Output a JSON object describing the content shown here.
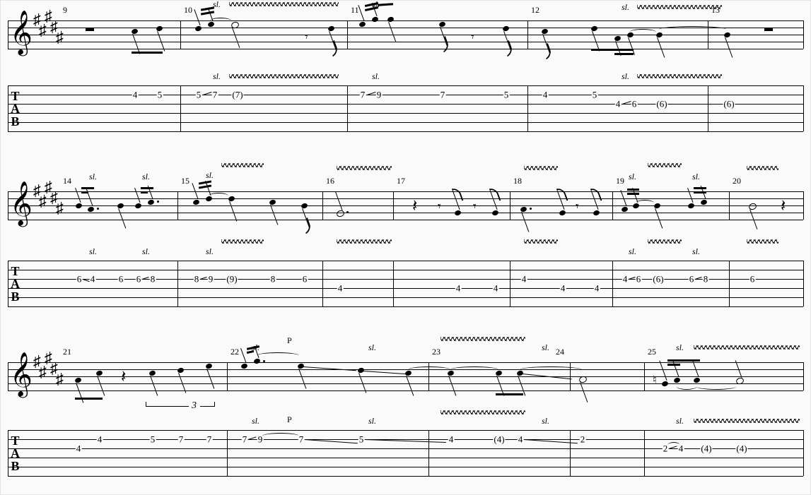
{
  "notation": {
    "clef": "treble",
    "key_signature": {
      "sharps": 5,
      "key": "B major / G# minor"
    },
    "tab_clef": [
      "T",
      "A",
      "B"
    ]
  },
  "annotations": {
    "slide": "sl.",
    "pulloff": "P",
    "tuplet3": "3"
  },
  "systems": [
    {
      "measures": [
        {
          "number": "9",
          "staff_events": [
            {
              "kind": "rest",
              "dur": "half"
            },
            {
              "kind": "note",
              "dur": "8"
            },
            {
              "kind": "note",
              "dur": "8"
            }
          ],
          "tab": [
            {
              "string": 2,
              "fret": "4"
            },
            {
              "string": 2,
              "fret": "5"
            }
          ],
          "ornaments": []
        },
        {
          "number": "10",
          "staff_events": [
            {
              "kind": "note",
              "dur": "16",
              "slide_to_next": true
            },
            {
              "kind": "note",
              "dur": "16"
            },
            {
              "kind": "note",
              "dur": "half",
              "tied_from_prev": true,
              "vibrato": true
            },
            {
              "kind": "rest",
              "dur": "8"
            },
            {
              "kind": "note",
              "dur": "8"
            }
          ],
          "tab": [
            {
              "string": 2,
              "fret": "5",
              "slide": true
            },
            {
              "string": 2,
              "fret": "7"
            },
            {
              "string": 2,
              "fret": "(7)"
            }
          ],
          "ornaments": [
            "sl.",
            "vibrato"
          ]
        },
        {
          "number": "11",
          "staff_events": [
            {
              "kind": "note",
              "dur": "16",
              "slide_to_next": true
            },
            {
              "kind": "note",
              "dur": "16"
            },
            {
              "kind": "note",
              "dur": "8"
            },
            {
              "kind": "note",
              "dur": "8"
            },
            {
              "kind": "rest",
              "dur": "8"
            },
            {
              "kind": "note",
              "dur": "8"
            }
          ],
          "tab": [
            {
              "string": 2,
              "fret": "7",
              "slide": true
            },
            {
              "string": 2,
              "fret": "9"
            },
            {
              "string": 2,
              "fret": "7"
            },
            {
              "string": 2,
              "fret": "5"
            }
          ],
          "ornaments": [
            "sl."
          ]
        },
        {
          "number": "12",
          "staff_events": [
            {
              "kind": "note",
              "dur": "8"
            },
            {
              "kind": "note",
              "dur": "8"
            },
            {
              "kind": "note",
              "dur": "16",
              "slide_to_next": true
            },
            {
              "kind": "note",
              "dur": "16"
            },
            {
              "kind": "note",
              "dur": "q",
              "tied_from_prev": true,
              "vibrato": true
            }
          ],
          "tab": [
            {
              "string": 2,
              "fret": "4"
            },
            {
              "string": 2,
              "fret": "5"
            },
            {
              "string": 3,
              "fret": "4",
              "slide": true
            },
            {
              "string": 3,
              "fret": "6"
            },
            {
              "string": 3,
              "fret": "(6)"
            }
          ],
          "ornaments": [
            "sl.",
            "vibrato"
          ]
        },
        {
          "number": "13",
          "staff_events": [
            {
              "kind": "note",
              "dur": "q",
              "tied_from_prev_measure": true
            },
            {
              "kind": "rest",
              "dur": "half"
            }
          ],
          "tab": [
            {
              "string": 3,
              "fret": "(6)"
            }
          ],
          "ornaments": []
        }
      ]
    },
    {
      "measures": [
        {
          "number": "14",
          "staff_events": [
            {
              "kind": "note",
              "dur": "16",
              "slide_to_next": true
            },
            {
              "kind": "note",
              "dur": "8.",
              "dotted": true
            },
            {
              "kind": "note",
              "dur": "8"
            },
            {
              "kind": "note",
              "dur": "16",
              "slide_to_next": true
            },
            {
              "kind": "note",
              "dur": "8.",
              "dotted": true
            }
          ],
          "tab": [
            {
              "string": 3,
              "fret": "6",
              "slide": true
            },
            {
              "string": 3,
              "fret": "4"
            },
            {
              "string": 3,
              "fret": "6"
            },
            {
              "string": 3,
              "fret": "6",
              "slide": true
            },
            {
              "string": 3,
              "fret": "8"
            }
          ],
          "ornaments": [
            "sl.",
            "sl."
          ]
        },
        {
          "number": "15",
          "staff_events": [
            {
              "kind": "note",
              "dur": "16",
              "slide_to_next": true
            },
            {
              "kind": "note",
              "dur": "16"
            },
            {
              "kind": "note",
              "dur": "q",
              "tied_from_prev": true,
              "vibrato": true
            },
            {
              "kind": "note",
              "dur": "q"
            },
            {
              "kind": "note",
              "dur": "8"
            }
          ],
          "tab": [
            {
              "string": 3,
              "fret": "8",
              "slide": true
            },
            {
              "string": 3,
              "fret": "9"
            },
            {
              "string": 3,
              "fret": "(9)"
            },
            {
              "string": 3,
              "fret": "8"
            },
            {
              "string": 3,
              "fret": "6"
            }
          ],
          "ornaments": [
            "sl.",
            "vibrato"
          ]
        },
        {
          "number": "16",
          "staff_events": [
            {
              "kind": "note",
              "dur": "half.",
              "dotted": true,
              "vibrato": true
            }
          ],
          "tab": [
            {
              "string": 4,
              "fret": "4"
            }
          ],
          "ornaments": [
            "vibrato"
          ]
        },
        {
          "number": "17",
          "staff_events": [
            {
              "kind": "rest",
              "dur": "q"
            },
            {
              "kind": "rest",
              "dur": "8"
            },
            {
              "kind": "note",
              "dur": "8"
            },
            {
              "kind": "rest",
              "dur": "8"
            },
            {
              "kind": "note",
              "dur": "8"
            }
          ],
          "tab": [
            {
              "string": 4,
              "fret": "4"
            },
            {
              "string": 4,
              "fret": "4"
            }
          ],
          "ornaments": []
        },
        {
          "number": "18",
          "staff_events": [
            {
              "kind": "note",
              "dur": "q.",
              "dotted": true,
              "vibrato": true
            },
            {
              "kind": "note",
              "dur": "8"
            },
            {
              "kind": "rest",
              "dur": "8"
            },
            {
              "kind": "note",
              "dur": "8"
            }
          ],
          "tab": [
            {
              "string": 3,
              "fret": "4"
            },
            {
              "string": 4,
              "fret": "4"
            },
            {
              "string": 4,
              "fret": "4"
            }
          ],
          "ornaments": [
            "vibrato"
          ]
        },
        {
          "number": "19",
          "staff_events": [
            {
              "kind": "note",
              "dur": "16",
              "slide_to_next": true
            },
            {
              "kind": "note",
              "dur": "16"
            },
            {
              "kind": "note",
              "dur": "q",
              "tied_from_prev": true,
              "vibrato": true
            },
            {
              "kind": "note",
              "dur": "16",
              "slide_to_next": true
            },
            {
              "kind": "note",
              "dur": "16"
            }
          ],
          "tab": [
            {
              "string": 3,
              "fret": "4",
              "slide": true
            },
            {
              "string": 3,
              "fret": "6"
            },
            {
              "string": 3,
              "fret": "(6)"
            },
            {
              "string": 3,
              "fret": "6",
              "slide": true
            },
            {
              "string": 3,
              "fret": "8"
            }
          ],
          "ornaments": [
            "sl.",
            "vibrato",
            "sl."
          ]
        },
        {
          "number": "20",
          "staff_events": [
            {
              "kind": "note",
              "dur": "half",
              "vibrato": true
            },
            {
              "kind": "rest",
              "dur": "q"
            }
          ],
          "tab": [
            {
              "string": 3,
              "fret": "6"
            }
          ],
          "ornaments": [
            "vibrato"
          ]
        }
      ]
    },
    {
      "measures": [
        {
          "number": "21",
          "staff_events": [
            {
              "kind": "note",
              "dur": "8"
            },
            {
              "kind": "note",
              "dur": "8"
            },
            {
              "kind": "rest",
              "dur": "q"
            },
            {
              "kind": "tuplet3",
              "notes": [
                {
                  "kind": "note",
                  "dur": "q"
                },
                {
                  "kind": "note",
                  "dur": "q"
                },
                {
                  "kind": "note",
                  "dur": "q"
                }
              ]
            }
          ],
          "tab": [
            {
              "string": 3,
              "fret": "4"
            },
            {
              "string": 2,
              "fret": "4"
            },
            {
              "string": 2,
              "fret": "5"
            },
            {
              "string": 2,
              "fret": "7"
            }
          ],
          "ornaments": []
        },
        {
          "number": "22",
          "staff_events": [
            {
              "kind": "note",
              "dur": "16",
              "slide_to_next": true
            },
            {
              "kind": "note",
              "dur": "8.",
              "dotted": true
            },
            {
              "kind": "note",
              "dur": "q",
              "pulloff_to_next": true
            },
            {
              "kind": "note",
              "dur": "q",
              "tied_to_next": true,
              "slide_to_next": true
            },
            {
              "kind": "note",
              "dur": "q"
            }
          ],
          "tab": [
            {
              "string": 2,
              "fret": "7",
              "slide": true
            },
            {
              "string": 2,
              "fret": "9"
            },
            {
              "string": 2,
              "fret": "7"
            },
            {
              "string": 2,
              "fret": "5",
              "slide": true
            }
          ],
          "ornaments": [
            "sl.",
            "P",
            "sl."
          ]
        },
        {
          "number": "23",
          "staff_events": [
            {
              "kind": "note",
              "dur": "q",
              "tied_from_prev": true,
              "vibrato": true
            },
            {
              "kind": "note",
              "dur": "8"
            },
            {
              "kind": "note",
              "dur": "8",
              "tied_to_next": true,
              "slide_to_next": true
            }
          ],
          "tab": [
            {
              "string": 2,
              "fret": "4"
            },
            {
              "string": 2,
              "fret": "(4)"
            },
            {
              "string": 2,
              "fret": "4",
              "slide": true
            }
          ],
          "ornaments": [
            "vibrato",
            "sl."
          ]
        },
        {
          "number": "24",
          "staff_events": [
            {
              "kind": "note",
              "dur": "half",
              "tied_from_prev": true
            }
          ],
          "tab": [
            {
              "string": 2,
              "fret": "2"
            }
          ],
          "ornaments": []
        },
        {
          "number": "25",
          "staff_events": [
            {
              "kind": "note",
              "dur": "16",
              "accidental": "natural",
              "slide_to_next": true
            },
            {
              "kind": "note",
              "dur": "16"
            },
            {
              "kind": "note",
              "dur": "8",
              "tied_from_prev": true
            },
            {
              "kind": "note",
              "dur": "q",
              "tied_from_prev": true,
              "vibrato": true
            }
          ],
          "tab": [
            {
              "string": 3,
              "fret": "2",
              "slide": true
            },
            {
              "string": 3,
              "fret": "4"
            },
            {
              "string": 3,
              "fret": "(4)"
            },
            {
              "string": 3,
              "fret": "(4)"
            }
          ],
          "ornaments": [
            "sl.",
            "vibrato"
          ]
        }
      ]
    }
  ]
}
